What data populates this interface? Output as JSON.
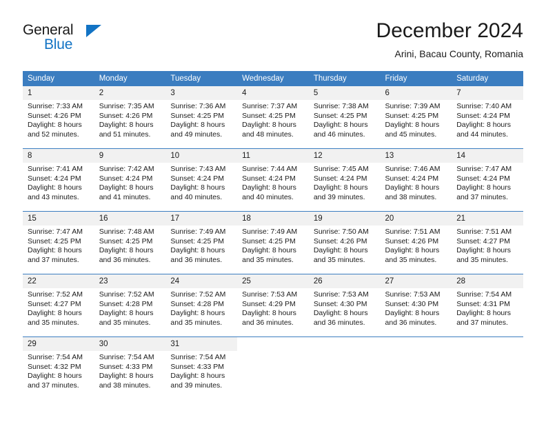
{
  "brand": {
    "name_primary": "General",
    "name_secondary": "Blue",
    "triangle_color": "#1273c4"
  },
  "header": {
    "month_title": "December 2024",
    "location": "Arini, Bacau County, Romania"
  },
  "theme": {
    "header_blue": "#3b7dc0",
    "daynum_background": "#f1f1f1",
    "text_color": "#1a1a1a",
    "brand_blue": "#1273c4"
  },
  "weekday_headers": [
    "Sunday",
    "Monday",
    "Tuesday",
    "Wednesday",
    "Thursday",
    "Friday",
    "Saturday"
  ],
  "labels": {
    "sunrise_prefix": "Sunrise:",
    "sunset_prefix": "Sunset:",
    "daylight_prefix": "Daylight:"
  },
  "weeks": [
    [
      {
        "day": "1",
        "sunrise": "Sunrise: 7:33 AM",
        "sunset": "Sunset: 4:26 PM",
        "daylight_l1": "Daylight: 8 hours",
        "daylight_l2": "and 52 minutes."
      },
      {
        "day": "2",
        "sunrise": "Sunrise: 7:35 AM",
        "sunset": "Sunset: 4:26 PM",
        "daylight_l1": "Daylight: 8 hours",
        "daylight_l2": "and 51 minutes."
      },
      {
        "day": "3",
        "sunrise": "Sunrise: 7:36 AM",
        "sunset": "Sunset: 4:25 PM",
        "daylight_l1": "Daylight: 8 hours",
        "daylight_l2": "and 49 minutes."
      },
      {
        "day": "4",
        "sunrise": "Sunrise: 7:37 AM",
        "sunset": "Sunset: 4:25 PM",
        "daylight_l1": "Daylight: 8 hours",
        "daylight_l2": "and 48 minutes."
      },
      {
        "day": "5",
        "sunrise": "Sunrise: 7:38 AM",
        "sunset": "Sunset: 4:25 PM",
        "daylight_l1": "Daylight: 8 hours",
        "daylight_l2": "and 46 minutes."
      },
      {
        "day": "6",
        "sunrise": "Sunrise: 7:39 AM",
        "sunset": "Sunset: 4:25 PM",
        "daylight_l1": "Daylight: 8 hours",
        "daylight_l2": "and 45 minutes."
      },
      {
        "day": "7",
        "sunrise": "Sunrise: 7:40 AM",
        "sunset": "Sunset: 4:24 PM",
        "daylight_l1": "Daylight: 8 hours",
        "daylight_l2": "and 44 minutes."
      }
    ],
    [
      {
        "day": "8",
        "sunrise": "Sunrise: 7:41 AM",
        "sunset": "Sunset: 4:24 PM",
        "daylight_l1": "Daylight: 8 hours",
        "daylight_l2": "and 43 minutes."
      },
      {
        "day": "9",
        "sunrise": "Sunrise: 7:42 AM",
        "sunset": "Sunset: 4:24 PM",
        "daylight_l1": "Daylight: 8 hours",
        "daylight_l2": "and 41 minutes."
      },
      {
        "day": "10",
        "sunrise": "Sunrise: 7:43 AM",
        "sunset": "Sunset: 4:24 PM",
        "daylight_l1": "Daylight: 8 hours",
        "daylight_l2": "and 40 minutes."
      },
      {
        "day": "11",
        "sunrise": "Sunrise: 7:44 AM",
        "sunset": "Sunset: 4:24 PM",
        "daylight_l1": "Daylight: 8 hours",
        "daylight_l2": "and 40 minutes."
      },
      {
        "day": "12",
        "sunrise": "Sunrise: 7:45 AM",
        "sunset": "Sunset: 4:24 PM",
        "daylight_l1": "Daylight: 8 hours",
        "daylight_l2": "and 39 minutes."
      },
      {
        "day": "13",
        "sunrise": "Sunrise: 7:46 AM",
        "sunset": "Sunset: 4:24 PM",
        "daylight_l1": "Daylight: 8 hours",
        "daylight_l2": "and 38 minutes."
      },
      {
        "day": "14",
        "sunrise": "Sunrise: 7:47 AM",
        "sunset": "Sunset: 4:24 PM",
        "daylight_l1": "Daylight: 8 hours",
        "daylight_l2": "and 37 minutes."
      }
    ],
    [
      {
        "day": "15",
        "sunrise": "Sunrise: 7:47 AM",
        "sunset": "Sunset: 4:25 PM",
        "daylight_l1": "Daylight: 8 hours",
        "daylight_l2": "and 37 minutes."
      },
      {
        "day": "16",
        "sunrise": "Sunrise: 7:48 AM",
        "sunset": "Sunset: 4:25 PM",
        "daylight_l1": "Daylight: 8 hours",
        "daylight_l2": "and 36 minutes."
      },
      {
        "day": "17",
        "sunrise": "Sunrise: 7:49 AM",
        "sunset": "Sunset: 4:25 PM",
        "daylight_l1": "Daylight: 8 hours",
        "daylight_l2": "and 36 minutes."
      },
      {
        "day": "18",
        "sunrise": "Sunrise: 7:49 AM",
        "sunset": "Sunset: 4:25 PM",
        "daylight_l1": "Daylight: 8 hours",
        "daylight_l2": "and 35 minutes."
      },
      {
        "day": "19",
        "sunrise": "Sunrise: 7:50 AM",
        "sunset": "Sunset: 4:26 PM",
        "daylight_l1": "Daylight: 8 hours",
        "daylight_l2": "and 35 minutes."
      },
      {
        "day": "20",
        "sunrise": "Sunrise: 7:51 AM",
        "sunset": "Sunset: 4:26 PM",
        "daylight_l1": "Daylight: 8 hours",
        "daylight_l2": "and 35 minutes."
      },
      {
        "day": "21",
        "sunrise": "Sunrise: 7:51 AM",
        "sunset": "Sunset: 4:27 PM",
        "daylight_l1": "Daylight: 8 hours",
        "daylight_l2": "and 35 minutes."
      }
    ],
    [
      {
        "day": "22",
        "sunrise": "Sunrise: 7:52 AM",
        "sunset": "Sunset: 4:27 PM",
        "daylight_l1": "Daylight: 8 hours",
        "daylight_l2": "and 35 minutes."
      },
      {
        "day": "23",
        "sunrise": "Sunrise: 7:52 AM",
        "sunset": "Sunset: 4:28 PM",
        "daylight_l1": "Daylight: 8 hours",
        "daylight_l2": "and 35 minutes."
      },
      {
        "day": "24",
        "sunrise": "Sunrise: 7:52 AM",
        "sunset": "Sunset: 4:28 PM",
        "daylight_l1": "Daylight: 8 hours",
        "daylight_l2": "and 35 minutes."
      },
      {
        "day": "25",
        "sunrise": "Sunrise: 7:53 AM",
        "sunset": "Sunset: 4:29 PM",
        "daylight_l1": "Daylight: 8 hours",
        "daylight_l2": "and 36 minutes."
      },
      {
        "day": "26",
        "sunrise": "Sunrise: 7:53 AM",
        "sunset": "Sunset: 4:30 PM",
        "daylight_l1": "Daylight: 8 hours",
        "daylight_l2": "and 36 minutes."
      },
      {
        "day": "27",
        "sunrise": "Sunrise: 7:53 AM",
        "sunset": "Sunset: 4:30 PM",
        "daylight_l1": "Daylight: 8 hours",
        "daylight_l2": "and 36 minutes."
      },
      {
        "day": "28",
        "sunrise": "Sunrise: 7:54 AM",
        "sunset": "Sunset: 4:31 PM",
        "daylight_l1": "Daylight: 8 hours",
        "daylight_l2": "and 37 minutes."
      }
    ],
    [
      {
        "day": "29",
        "sunrise": "Sunrise: 7:54 AM",
        "sunset": "Sunset: 4:32 PM",
        "daylight_l1": "Daylight: 8 hours",
        "daylight_l2": "and 37 minutes."
      },
      {
        "day": "30",
        "sunrise": "Sunrise: 7:54 AM",
        "sunset": "Sunset: 4:33 PM",
        "daylight_l1": "Daylight: 8 hours",
        "daylight_l2": "and 38 minutes."
      },
      {
        "day": "31",
        "sunrise": "Sunrise: 7:54 AM",
        "sunset": "Sunset: 4:33 PM",
        "daylight_l1": "Daylight: 8 hours",
        "daylight_l2": "and 39 minutes."
      },
      {
        "day": "",
        "sunrise": "",
        "sunset": "",
        "daylight_l1": "",
        "daylight_l2": ""
      },
      {
        "day": "",
        "sunrise": "",
        "sunset": "",
        "daylight_l1": "",
        "daylight_l2": ""
      },
      {
        "day": "",
        "sunrise": "",
        "sunset": "",
        "daylight_l1": "",
        "daylight_l2": ""
      },
      {
        "day": "",
        "sunrise": "",
        "sunset": "",
        "daylight_l1": "",
        "daylight_l2": ""
      }
    ]
  ]
}
